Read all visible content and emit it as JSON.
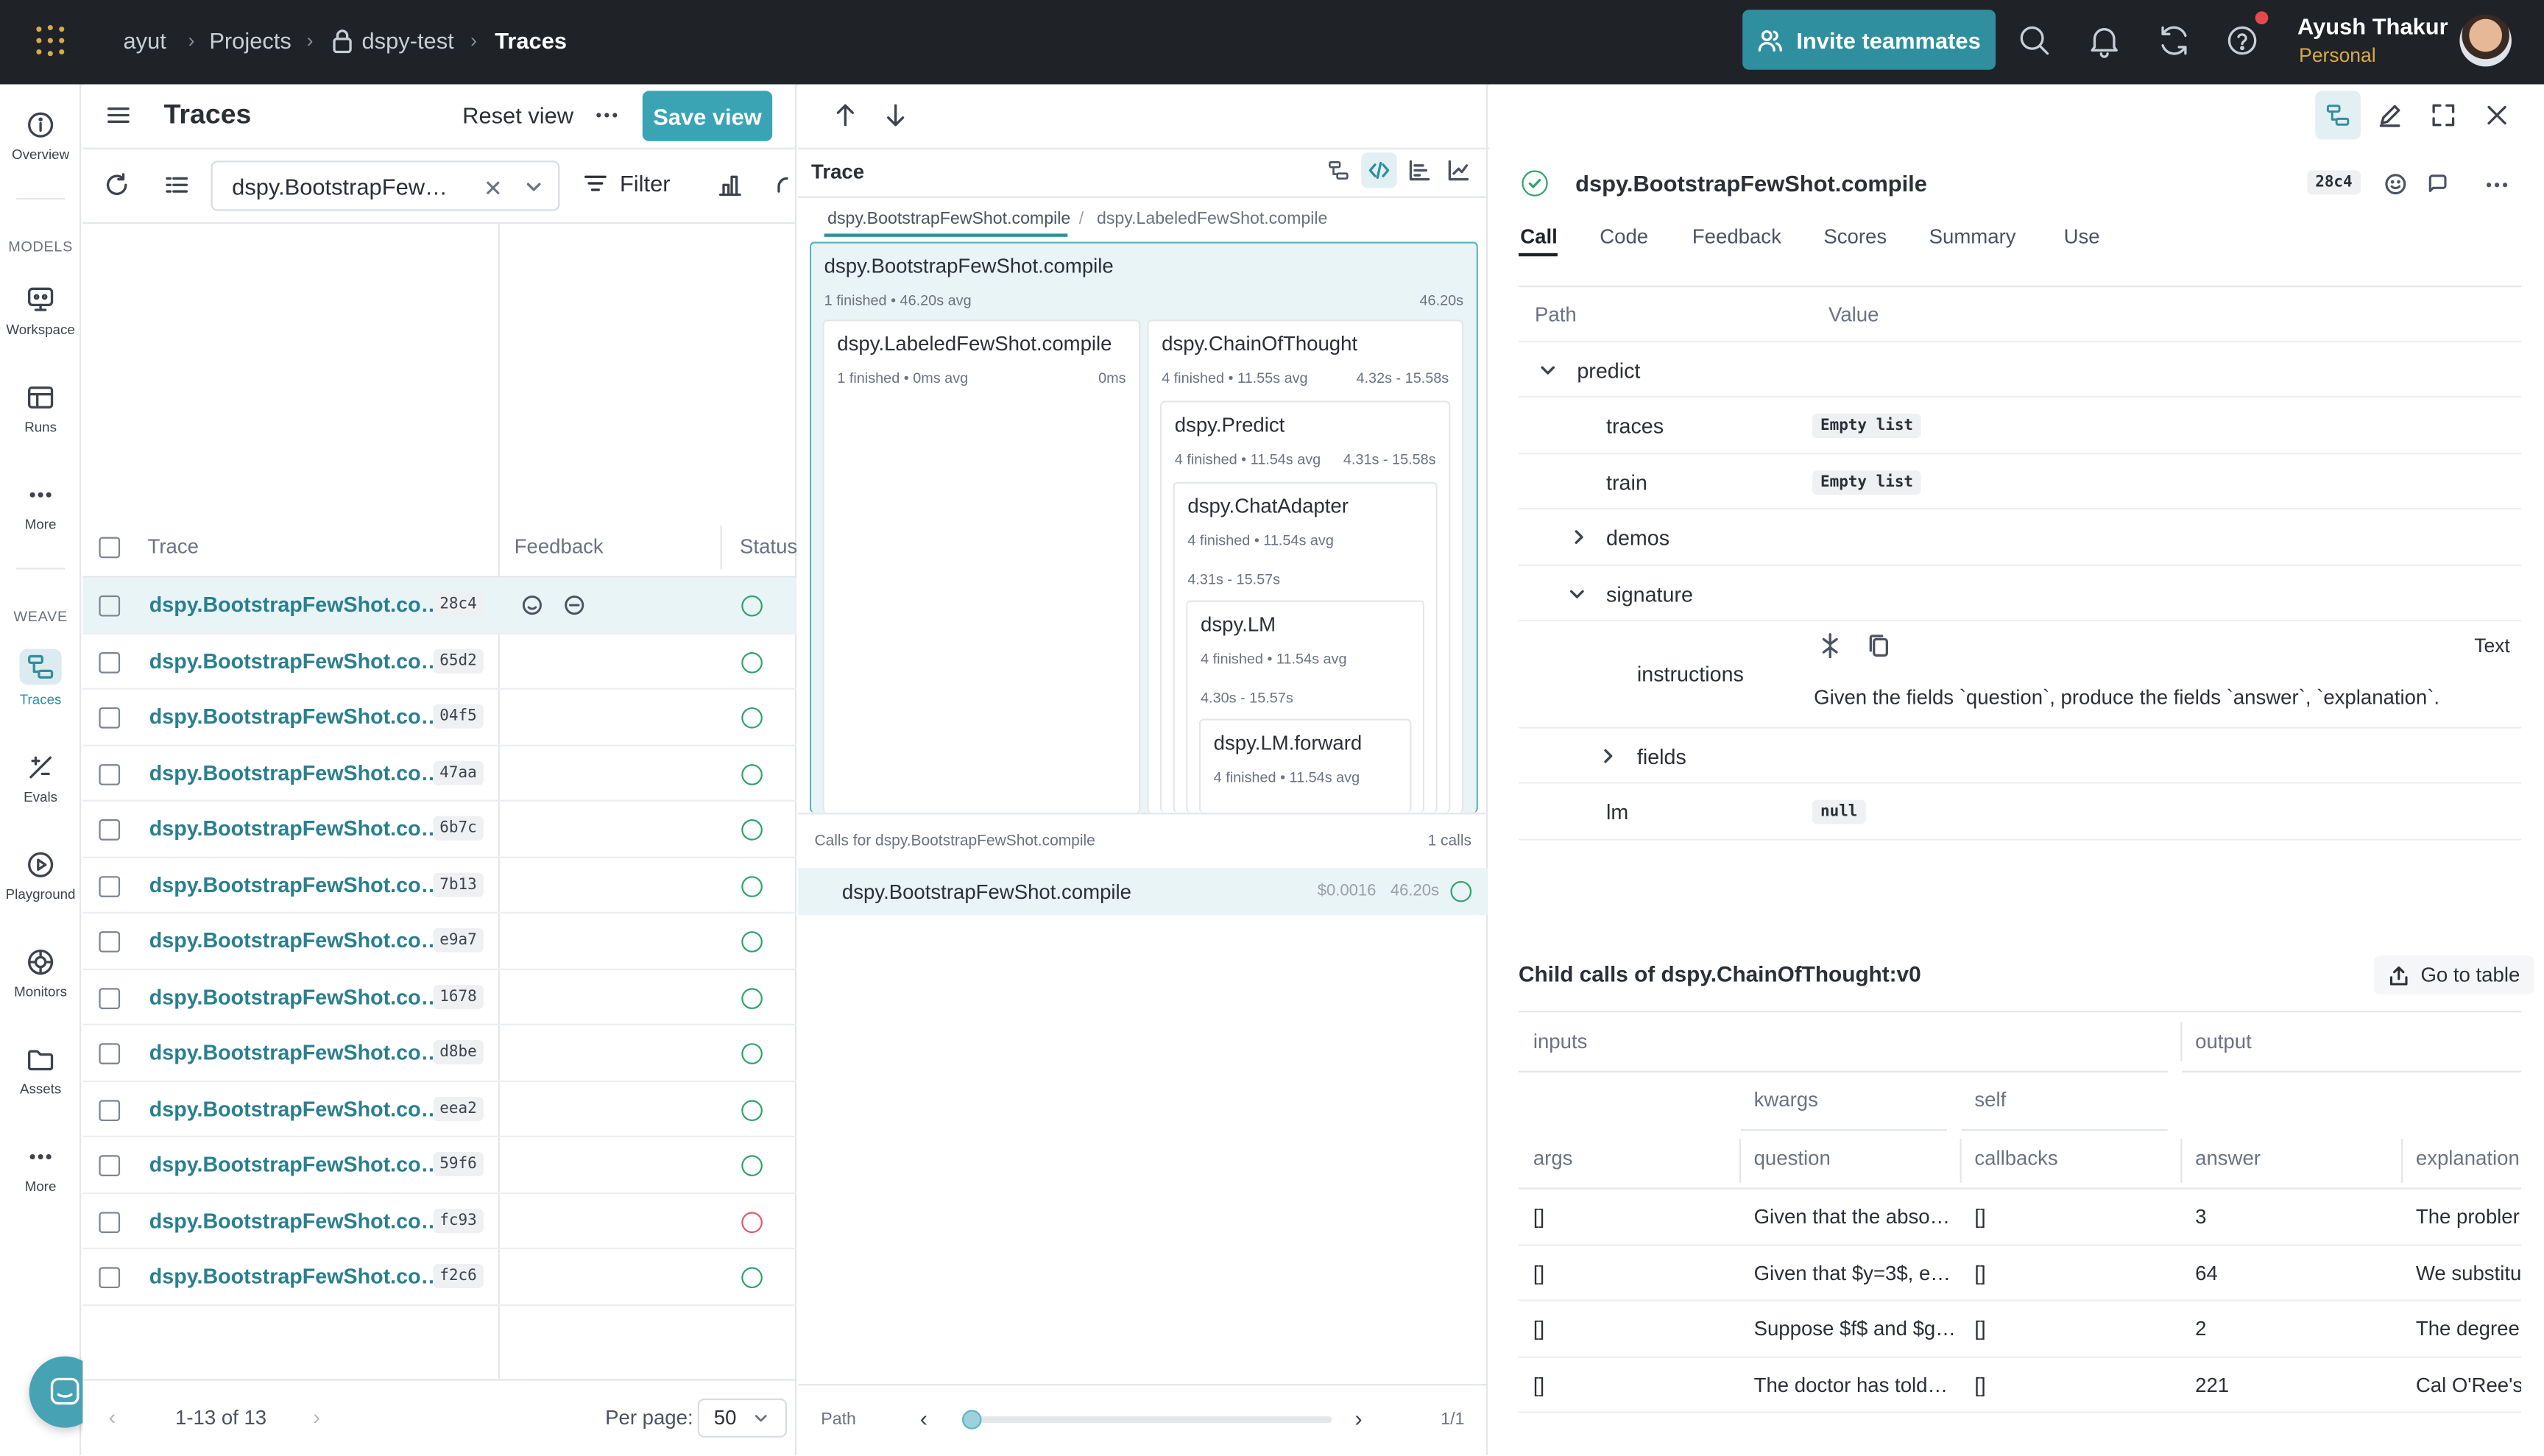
{
  "topbar": {
    "crumbs": [
      "ayut",
      "Projects",
      "dspy-test",
      "Traces"
    ],
    "invite_label": "Invite teammates",
    "user_name": "Ayush Thakur",
    "user_plan": "Personal"
  },
  "nav": {
    "items": [
      {
        "label": "Overview",
        "icon": "info-icon"
      },
      {
        "label": "Workspace",
        "icon": "workspace-icon"
      },
      {
        "label": "Runs",
        "icon": "table-icon"
      },
      {
        "label": "More",
        "icon": "dots-icon"
      },
      {
        "label": "Traces",
        "icon": "traces-icon"
      },
      {
        "label": "Evals",
        "icon": "evals-icon"
      },
      {
        "label": "Playground",
        "icon": "play-icon"
      },
      {
        "label": "Monitors",
        "icon": "monitor-icon"
      },
      {
        "label": "Assets",
        "icon": "folder-icon"
      },
      {
        "label": "More",
        "icon": "dots-icon"
      }
    ],
    "section_models": "MODELS",
    "section_weave": "WEAVE"
  },
  "traces": {
    "title": "Traces",
    "reset_label": "Reset view",
    "save_label": "Save view",
    "op_filter": "dspy.BootstrapFew…",
    "filter_label": "Filter",
    "columns": {
      "trace": "Trace",
      "feedback": "Feedback",
      "status": "Status"
    },
    "rows": [
      {
        "name": "dspy.BootstrapFewShot.co…",
        "id": "28c4",
        "status": "success"
      },
      {
        "name": "dspy.BootstrapFewShot.co…",
        "id": "65d2",
        "status": "success"
      },
      {
        "name": "dspy.BootstrapFewShot.co…",
        "id": "04f5",
        "status": "success"
      },
      {
        "name": "dspy.BootstrapFewShot.co…",
        "id": "47aa",
        "status": "success"
      },
      {
        "name": "dspy.BootstrapFewShot.co…",
        "id": "6b7c",
        "status": "success"
      },
      {
        "name": "dspy.BootstrapFewShot.co…",
        "id": "7b13",
        "status": "success"
      },
      {
        "name": "dspy.BootstrapFewShot.co…",
        "id": "e9a7",
        "status": "success"
      },
      {
        "name": "dspy.BootstrapFewShot.co…",
        "id": "1678",
        "status": "success"
      },
      {
        "name": "dspy.BootstrapFewShot.co…",
        "id": "d8be",
        "status": "success"
      },
      {
        "name": "dspy.BootstrapFewShot.co…",
        "id": "eea2",
        "status": "success"
      },
      {
        "name": "dspy.BootstrapFewShot.co…",
        "id": "59f6",
        "status": "success"
      },
      {
        "name": "dspy.BootstrapFewShot.co…",
        "id": "fc93",
        "status": "error"
      },
      {
        "name": "dspy.BootstrapFewShot.co…",
        "id": "f2c6",
        "status": "success"
      }
    ],
    "pagination": "1-13 of 13",
    "per_page_label": "Per page:",
    "per_page_value": "50"
  },
  "trace": {
    "title": "Trace",
    "breadcrumb": [
      "dspy.BootstrapFewShot.compile",
      "dspy.LabeledFewShot.compile"
    ],
    "nodes": {
      "root": {
        "name": "dspy.BootstrapFewShot.compile",
        "stats": "1 finished • 46.20s avg",
        "range": "46.20s"
      },
      "labeled": {
        "name": "dspy.LabeledFewShot.compile",
        "stats": "1 finished • 0ms avg",
        "range": "0ms"
      },
      "cot": {
        "name": "dspy.ChainOfThought",
        "stats": "4 finished • 11.55s avg",
        "range": "4.32s - 15.58s"
      },
      "predict": {
        "name": "dspy.Predict",
        "stats": "4 finished • 11.54s avg",
        "range": "4.31s - 15.58s"
      },
      "adapter": {
        "name": "dspy.ChatAdapter",
        "stats": "4 finished • 11.54s avg",
        "range": "4.31s - 15.57s"
      },
      "lm": {
        "name": "dspy.LM",
        "stats": "4 finished • 11.54s avg",
        "range": "4.30s - 15.57s"
      },
      "forward": {
        "name": "dspy.LM.forward",
        "stats": "4 finished • 11.54s avg"
      }
    },
    "calls_header": "Calls for dspy.BootstrapFewShot.compile",
    "calls_count": "1 calls",
    "call": {
      "name": "dspy.BootstrapFewShot.compile",
      "cost": "$0.0016",
      "duration": "46.20s"
    },
    "path_label": "Path",
    "path_pos": "1/1",
    "path_progress": 0
  },
  "call": {
    "title": "dspy.BootstrapFewShot.compile",
    "id": "28c4",
    "tabs": [
      "Call",
      "Code",
      "Feedback",
      "Scores",
      "Summary",
      "Use"
    ],
    "header": {
      "path": "Path",
      "value": "Value"
    },
    "rows": {
      "predict": "predict",
      "traces": "traces",
      "traces_val": "Empty list",
      "train": "train",
      "train_val": "Empty list",
      "demos": "demos",
      "signature": "signature",
      "instructions": "instructions",
      "instructions_mode": "Text",
      "instructions_val": "Given the fields `question`, produce the fields `answer`, `explanation`.",
      "fields": "fields",
      "lm": "lm",
      "lm_val": "null"
    },
    "child_title": "Child calls of dspy.ChainOfThought:v0",
    "goto_label": "Go to table",
    "child_headers": {
      "inputs": "inputs",
      "output": "output",
      "kwargs": "kwargs",
      "self": "self",
      "args": "args",
      "question": "question",
      "callbacks": "callbacks",
      "answer": "answer",
      "explanation": "explanation"
    },
    "child_rows": [
      {
        "args": "[]",
        "question": "Given that the abso…",
        "callbacks": "[]",
        "answer": "3",
        "explanation": "The probler"
      },
      {
        "args": "[]",
        "question": "Given that $y=3$, e…",
        "callbacks": "[]",
        "answer": "64",
        "explanation": "We substitu"
      },
      {
        "args": "[]",
        "question": "Suppose $f$ and $g…",
        "callbacks": "[]",
        "answer": "2",
        "explanation": "The degree"
      },
      {
        "args": "[]",
        "question": "The doctor has told…",
        "callbacks": "[]",
        "answer": "221",
        "explanation": "Cal O'Ree's"
      }
    ]
  }
}
